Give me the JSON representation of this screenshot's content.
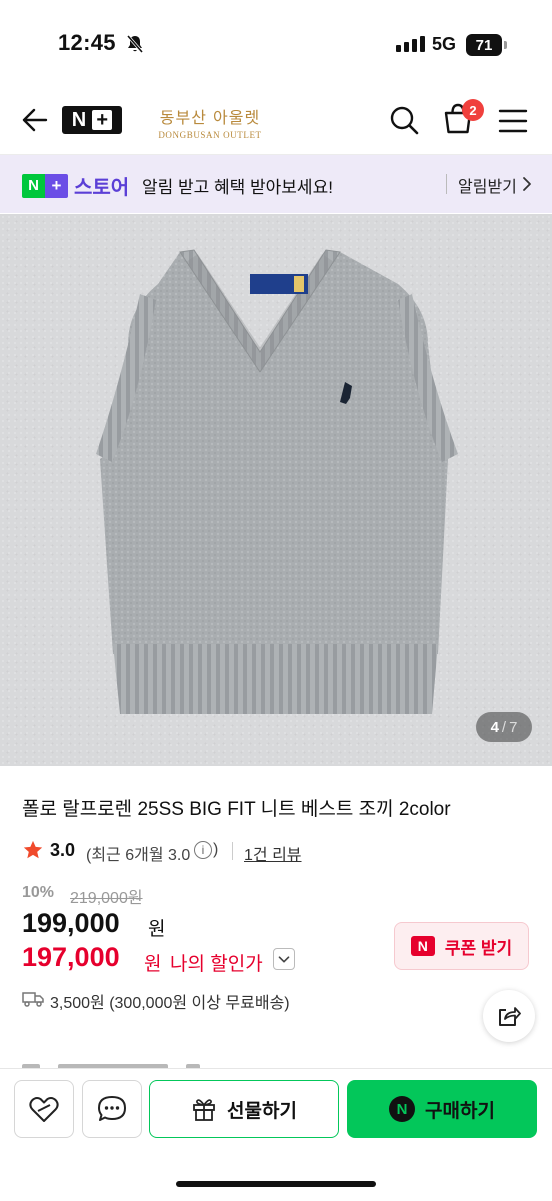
{
  "status_bar": {
    "time": "12:45",
    "network": "5G",
    "battery": "71"
  },
  "header": {
    "shop_name_ko": "동부산 아울렛",
    "shop_name_en": "DONGBUSAN OUTLET",
    "cart_count": "2"
  },
  "banner": {
    "logo_n": "N",
    "logo_plus": "+",
    "store": "스토어",
    "message": "알림 받고 혜택 받아보세요!",
    "cta": "알림받기"
  },
  "gallery": {
    "current": "4",
    "separator": "/",
    "total": "7"
  },
  "product": {
    "title": "폴로 랄프로렌 25SS BIG FIT 니트 베스트 조끼 2color",
    "rating": "3.0",
    "rating_sub": "(최근 6개월 3.0",
    "rating_info": "i",
    "rating_close": ")",
    "review_link": "1건 리뷰",
    "discount_rate": "10%",
    "original_price": "219,000원",
    "price": "199,000",
    "price_unit": "원",
    "my_price": "197,000",
    "my_price_unit": "원",
    "my_price_label": "나의 할인가",
    "coupon_icon": "N",
    "coupon_label": "쿠폰 받기",
    "shipping": "3,500원 (300,000원 이상 무료배송)"
  },
  "bottom_bar": {
    "gift_label": "선물하기",
    "buy_icon": "N",
    "buy_label": "구매하기"
  },
  "colors": {
    "naver_green": "#03c75a",
    "accent_red": "#e6002d",
    "store_purple": "#5b3fd6",
    "badge_red": "#f0403d"
  },
  "icons": [
    "back-arrow-icon",
    "search-icon",
    "cart-icon",
    "menu-icon",
    "bell-slash-icon",
    "star-icon",
    "truck-icon",
    "share-icon",
    "heart-icon",
    "chat-icon",
    "gift-icon",
    "chevron-right-icon",
    "chevron-down-icon"
  ]
}
